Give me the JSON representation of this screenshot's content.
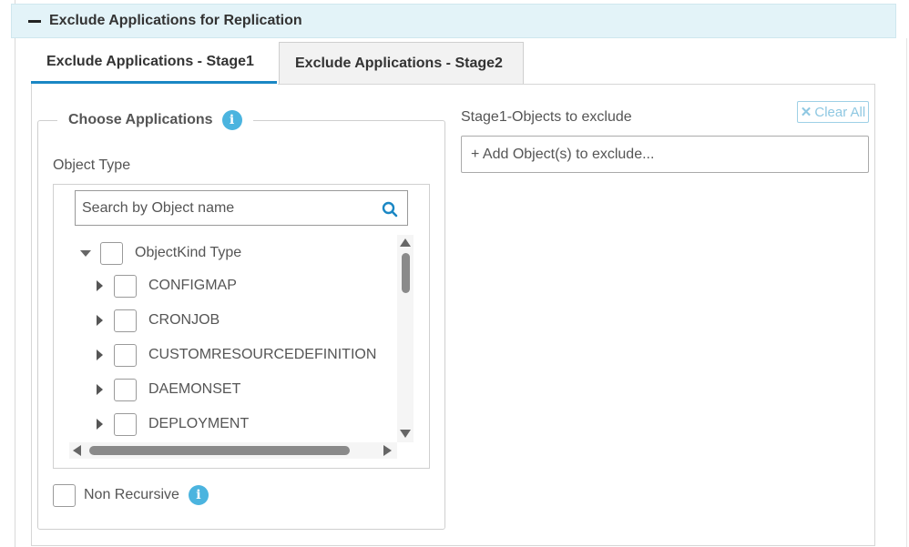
{
  "section": {
    "collapse_symbol": "−",
    "title": "Exclude Applications for Replication"
  },
  "tabs": [
    {
      "label": "Exclude Applications - Stage1",
      "active": true
    },
    {
      "label": "Exclude Applications - Stage2",
      "active": false
    }
  ],
  "choose": {
    "legend": "Choose Applications",
    "info_icon": "info-icon",
    "object_type_label": "Object Type",
    "search_placeholder": "Search by Object name",
    "tree": {
      "root": "ObjectKind Type",
      "children": [
        "CONFIGMAP",
        "CRONJOB",
        "CUSTOMRESOURCEDEFINITION",
        "DAEMONSET",
        "DEPLOYMENT"
      ]
    },
    "non_recursive_label": "Non Recursive"
  },
  "exclude": {
    "label": "Stage1-Objects to exclude",
    "clear_all": "Clear All",
    "add_placeholder": "+ Add Object(s) to exclude..."
  },
  "colors": {
    "header_bg": "#e3f3f8",
    "active_tab_underline": "#1a87c4",
    "info_icon": "#4bb4df",
    "clear_all": "#8fc8e2"
  }
}
